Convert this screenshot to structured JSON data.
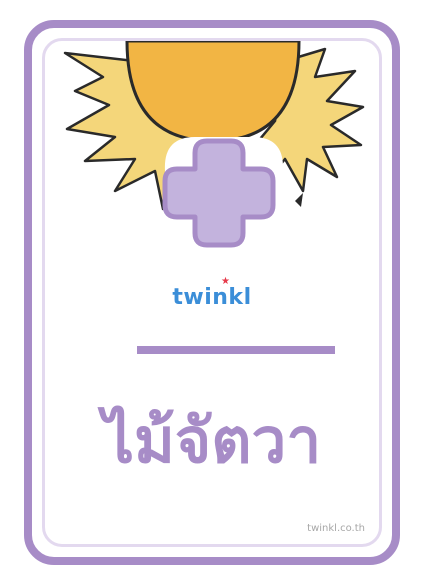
{
  "logo": {
    "text": "twinkl"
  },
  "word": {
    "text": "ไม้จัตวา"
  },
  "watermark": {
    "text": "twinkl.co.th"
  },
  "icons": {
    "top": "sun-icon",
    "symbol": "plus-sign-icon"
  },
  "colors": {
    "frame": "#a78cc7",
    "frame_inner": "#e3d9ef",
    "word": "#a78cc7",
    "plus_fill": "#c3b3dd",
    "plus_outline": "#a78cc7",
    "sun_body": "#f2b544",
    "sun_rays": "#f4d67a",
    "logo_text": "#3b8ed8",
    "logo_star": "#e63a4a",
    "watermark": "#a7a7a7"
  }
}
